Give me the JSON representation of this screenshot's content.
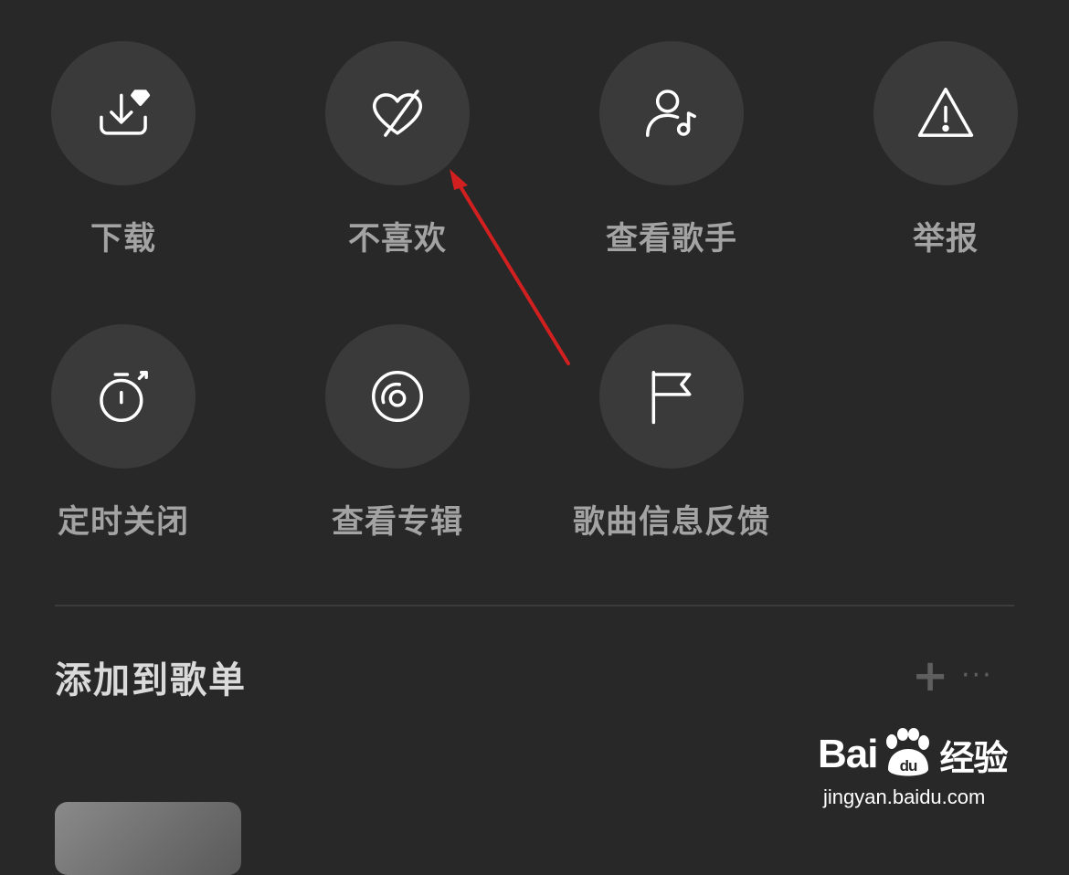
{
  "actions_row1": [
    {
      "label": "下载",
      "icon": "download-diamond-icon"
    },
    {
      "label": "不喜欢",
      "icon": "heart-slash-icon"
    },
    {
      "label": "查看歌手",
      "icon": "user-music-icon"
    },
    {
      "label": "举报",
      "icon": "warning-icon"
    }
  ],
  "actions_row2": [
    {
      "label": "定时关闭",
      "icon": "timer-icon"
    },
    {
      "label": "查看专辑",
      "icon": "vinyl-disc-icon"
    },
    {
      "label": "歌曲信息反馈",
      "icon": "flag-icon"
    }
  ],
  "playlist_section": {
    "title": "添加到歌单",
    "add_symbol": "+",
    "more_symbol": "···"
  },
  "watermark": {
    "logo_latin_1": "Bai",
    "logo_latin_2": "du",
    "logo_cn": "经验",
    "url": "jingyan.baidu.com"
  },
  "colors": {
    "background": "#282828",
    "circle": "#3a3a3a",
    "label": "#a3a3a3",
    "arrow": "#d21f1f"
  }
}
